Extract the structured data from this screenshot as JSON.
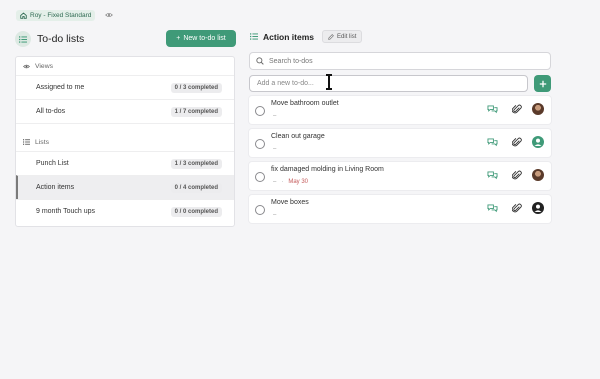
{
  "header": {
    "project": "Roy - Fixed Standard"
  },
  "left": {
    "title": "To-do lists",
    "new_button": "New to-do list",
    "views_label": "Views",
    "views": [
      {
        "label": "Assigned to me",
        "count": "0 / 3 completed"
      },
      {
        "label": "All to-dos",
        "count": "1 / 7 completed"
      }
    ],
    "lists_label": "Lists",
    "lists": [
      {
        "label": "Punch List",
        "count": "1 / 3 completed"
      },
      {
        "label": "Action items",
        "count": "0 / 4 completed",
        "active": true
      },
      {
        "label": "9 month Touch ups",
        "count": "0 / 0 completed"
      }
    ]
  },
  "right": {
    "title": "Action items",
    "edit_button": "Edit list",
    "search_placeholder": "Search to-dos",
    "add_placeholder": "Add a new to-do...",
    "todos": [
      {
        "title": "Move bathroom outlet",
        "meta": "–",
        "due": "",
        "avatar": "photo"
      },
      {
        "title": "Clean out garage",
        "meta": "–",
        "due": "",
        "avatar": "default-teal"
      },
      {
        "title": "fix damaged molding in Living Room",
        "meta": "–",
        "due": "May 30",
        "avatar": "photo"
      },
      {
        "title": "Move boxes",
        "meta": "–",
        "due": "",
        "avatar": "default-dark"
      }
    ]
  },
  "colors": {
    "accent": "#3f9a78",
    "due": "#c45a5a"
  }
}
